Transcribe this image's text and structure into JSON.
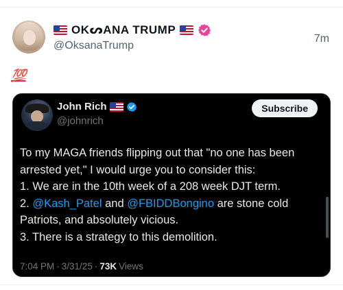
{
  "post": {
    "display_name": "OKᔕANA TRUMP",
    "handle": "@OksanaTrump",
    "time": "7m",
    "body_emoji": "💯"
  },
  "quote": {
    "name": "John Rich",
    "handle": "@johnrich",
    "subscribe_label": "Subscribe",
    "lines": {
      "l1": "To my MAGA friends flipping out that \"no one has been",
      "l2": "arrested yet,\" I would urge you to consider this:",
      "l3": "1. We are in the 10th week of a 208 week DJT term.",
      "l4_prefix": "2. ",
      "l4_mention1": "@Kash_Patel",
      "l4_mid": " and ",
      "l4_mention2": "@FBIDDBongino",
      "l4_suffix": " are stone cold",
      "l5": "Patriots, and absolutely vicious.",
      "l6": "3. There is a strategy to this demolition."
    },
    "meta": {
      "time": "7:04 PM",
      "date": "3/31/25",
      "views_count": "73K",
      "views_label": "Views",
      "sep": "·"
    }
  },
  "colors": {
    "verified_pink": "#e8459a",
    "verified_blue": "#1d9bf0",
    "mention": "#1d9bf0",
    "card_bg": "#000000"
  },
  "icons": {
    "flag": "us-flag-icon",
    "verified_pink": "verified-badge-pink-icon",
    "verified_blue": "verified-badge-blue-icon"
  }
}
